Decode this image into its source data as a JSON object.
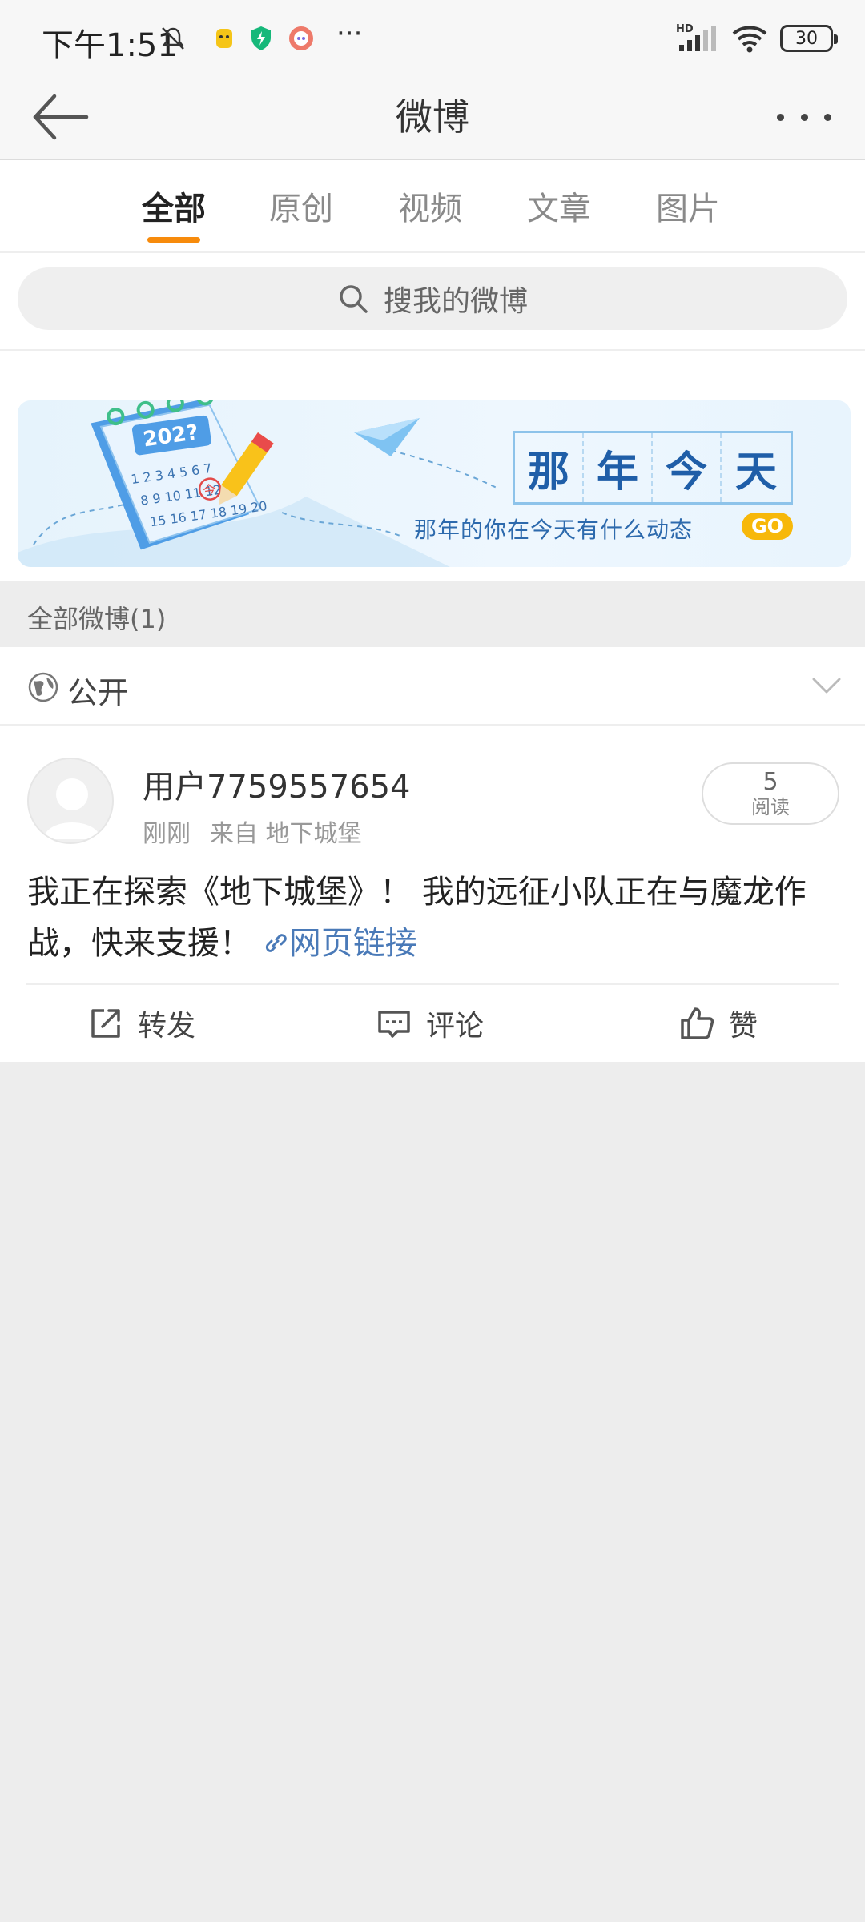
{
  "status_bar": {
    "time": "下午1:51",
    "network": "HD",
    "battery": "30",
    "more": "···"
  },
  "nav": {
    "title": "微博",
    "back_icon": "back-arrow-icon",
    "more_icon": "more-dots-icon"
  },
  "tabs": [
    {
      "label": "全部",
      "active": true
    },
    {
      "label": "原创",
      "active": false
    },
    {
      "label": "视频",
      "active": false
    },
    {
      "label": "文章",
      "active": false
    },
    {
      "label": "图片",
      "active": false
    }
  ],
  "colors": {
    "accent": "#f78b0c",
    "link": "#4a7ab8",
    "banner_title": "#1f5ea8",
    "go_badge": "#f7b80a"
  },
  "search": {
    "placeholder": "搜我的微博"
  },
  "banner": {
    "calendar_year": "202?",
    "calendar_day": "今",
    "title_chars": [
      "那",
      "年",
      "今",
      "天"
    ],
    "subtitle": "那年的你在今天有什么动态",
    "go": "GO"
  },
  "section": {
    "header": "全部微博(1)"
  },
  "filter": {
    "label": "公开"
  },
  "post": {
    "username": "用户7759557654",
    "time": "刚刚",
    "source": "来自 地下城堡",
    "read_count": "5",
    "read_label": "阅读",
    "text": "我正在探索《地下城堡》！ 我的远征小队正在与魔龙作战，快来支援！",
    "link_text": "网页链接",
    "actions": {
      "repost": "转发",
      "comment": "评论",
      "like": "赞"
    }
  }
}
